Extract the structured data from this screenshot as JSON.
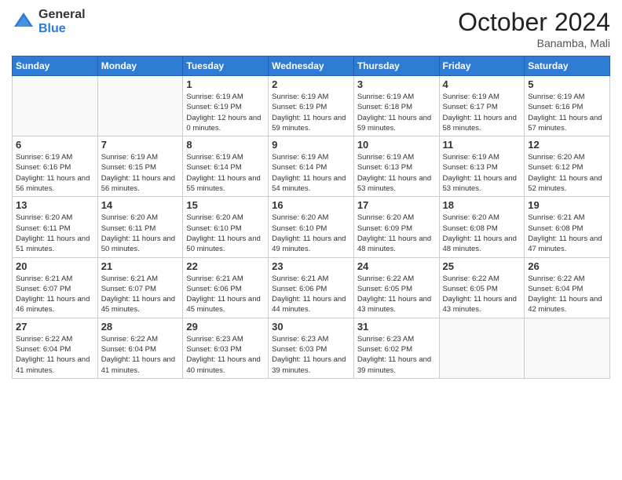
{
  "header": {
    "logo_general": "General",
    "logo_blue": "Blue",
    "month": "October 2024",
    "location": "Banamba, Mali"
  },
  "weekdays": [
    "Sunday",
    "Monday",
    "Tuesday",
    "Wednesday",
    "Thursday",
    "Friday",
    "Saturday"
  ],
  "weeks": [
    [
      {
        "day": "",
        "sunrise": "",
        "sunset": "",
        "daylight": ""
      },
      {
        "day": "",
        "sunrise": "",
        "sunset": "",
        "daylight": ""
      },
      {
        "day": "1",
        "sunrise": "Sunrise: 6:19 AM",
        "sunset": "Sunset: 6:19 PM",
        "daylight": "Daylight: 12 hours and 0 minutes."
      },
      {
        "day": "2",
        "sunrise": "Sunrise: 6:19 AM",
        "sunset": "Sunset: 6:19 PM",
        "daylight": "Daylight: 11 hours and 59 minutes."
      },
      {
        "day": "3",
        "sunrise": "Sunrise: 6:19 AM",
        "sunset": "Sunset: 6:18 PM",
        "daylight": "Daylight: 11 hours and 59 minutes."
      },
      {
        "day": "4",
        "sunrise": "Sunrise: 6:19 AM",
        "sunset": "Sunset: 6:17 PM",
        "daylight": "Daylight: 11 hours and 58 minutes."
      },
      {
        "day": "5",
        "sunrise": "Sunrise: 6:19 AM",
        "sunset": "Sunset: 6:16 PM",
        "daylight": "Daylight: 11 hours and 57 minutes."
      }
    ],
    [
      {
        "day": "6",
        "sunrise": "Sunrise: 6:19 AM",
        "sunset": "Sunset: 6:16 PM",
        "daylight": "Daylight: 11 hours and 56 minutes."
      },
      {
        "day": "7",
        "sunrise": "Sunrise: 6:19 AM",
        "sunset": "Sunset: 6:15 PM",
        "daylight": "Daylight: 11 hours and 56 minutes."
      },
      {
        "day": "8",
        "sunrise": "Sunrise: 6:19 AM",
        "sunset": "Sunset: 6:14 PM",
        "daylight": "Daylight: 11 hours and 55 minutes."
      },
      {
        "day": "9",
        "sunrise": "Sunrise: 6:19 AM",
        "sunset": "Sunset: 6:14 PM",
        "daylight": "Daylight: 11 hours and 54 minutes."
      },
      {
        "day": "10",
        "sunrise": "Sunrise: 6:19 AM",
        "sunset": "Sunset: 6:13 PM",
        "daylight": "Daylight: 11 hours and 53 minutes."
      },
      {
        "day": "11",
        "sunrise": "Sunrise: 6:19 AM",
        "sunset": "Sunset: 6:13 PM",
        "daylight": "Daylight: 11 hours and 53 minutes."
      },
      {
        "day": "12",
        "sunrise": "Sunrise: 6:20 AM",
        "sunset": "Sunset: 6:12 PM",
        "daylight": "Daylight: 11 hours and 52 minutes."
      }
    ],
    [
      {
        "day": "13",
        "sunrise": "Sunrise: 6:20 AM",
        "sunset": "Sunset: 6:11 PM",
        "daylight": "Daylight: 11 hours and 51 minutes."
      },
      {
        "day": "14",
        "sunrise": "Sunrise: 6:20 AM",
        "sunset": "Sunset: 6:11 PM",
        "daylight": "Daylight: 11 hours and 50 minutes."
      },
      {
        "day": "15",
        "sunrise": "Sunrise: 6:20 AM",
        "sunset": "Sunset: 6:10 PM",
        "daylight": "Daylight: 11 hours and 50 minutes."
      },
      {
        "day": "16",
        "sunrise": "Sunrise: 6:20 AM",
        "sunset": "Sunset: 6:10 PM",
        "daylight": "Daylight: 11 hours and 49 minutes."
      },
      {
        "day": "17",
        "sunrise": "Sunrise: 6:20 AM",
        "sunset": "Sunset: 6:09 PM",
        "daylight": "Daylight: 11 hours and 48 minutes."
      },
      {
        "day": "18",
        "sunrise": "Sunrise: 6:20 AM",
        "sunset": "Sunset: 6:08 PM",
        "daylight": "Daylight: 11 hours and 48 minutes."
      },
      {
        "day": "19",
        "sunrise": "Sunrise: 6:21 AM",
        "sunset": "Sunset: 6:08 PM",
        "daylight": "Daylight: 11 hours and 47 minutes."
      }
    ],
    [
      {
        "day": "20",
        "sunrise": "Sunrise: 6:21 AM",
        "sunset": "Sunset: 6:07 PM",
        "daylight": "Daylight: 11 hours and 46 minutes."
      },
      {
        "day": "21",
        "sunrise": "Sunrise: 6:21 AM",
        "sunset": "Sunset: 6:07 PM",
        "daylight": "Daylight: 11 hours and 45 minutes."
      },
      {
        "day": "22",
        "sunrise": "Sunrise: 6:21 AM",
        "sunset": "Sunset: 6:06 PM",
        "daylight": "Daylight: 11 hours and 45 minutes."
      },
      {
        "day": "23",
        "sunrise": "Sunrise: 6:21 AM",
        "sunset": "Sunset: 6:06 PM",
        "daylight": "Daylight: 11 hours and 44 minutes."
      },
      {
        "day": "24",
        "sunrise": "Sunrise: 6:22 AM",
        "sunset": "Sunset: 6:05 PM",
        "daylight": "Daylight: 11 hours and 43 minutes."
      },
      {
        "day": "25",
        "sunrise": "Sunrise: 6:22 AM",
        "sunset": "Sunset: 6:05 PM",
        "daylight": "Daylight: 11 hours and 43 minutes."
      },
      {
        "day": "26",
        "sunrise": "Sunrise: 6:22 AM",
        "sunset": "Sunset: 6:04 PM",
        "daylight": "Daylight: 11 hours and 42 minutes."
      }
    ],
    [
      {
        "day": "27",
        "sunrise": "Sunrise: 6:22 AM",
        "sunset": "Sunset: 6:04 PM",
        "daylight": "Daylight: 11 hours and 41 minutes."
      },
      {
        "day": "28",
        "sunrise": "Sunrise: 6:22 AM",
        "sunset": "Sunset: 6:04 PM",
        "daylight": "Daylight: 11 hours and 41 minutes."
      },
      {
        "day": "29",
        "sunrise": "Sunrise: 6:23 AM",
        "sunset": "Sunset: 6:03 PM",
        "daylight": "Daylight: 11 hours and 40 minutes."
      },
      {
        "day": "30",
        "sunrise": "Sunrise: 6:23 AM",
        "sunset": "Sunset: 6:03 PM",
        "daylight": "Daylight: 11 hours and 39 minutes."
      },
      {
        "day": "31",
        "sunrise": "Sunrise: 6:23 AM",
        "sunset": "Sunset: 6:02 PM",
        "daylight": "Daylight: 11 hours and 39 minutes."
      },
      {
        "day": "",
        "sunrise": "",
        "sunset": "",
        "daylight": ""
      },
      {
        "day": "",
        "sunrise": "",
        "sunset": "",
        "daylight": ""
      }
    ]
  ]
}
